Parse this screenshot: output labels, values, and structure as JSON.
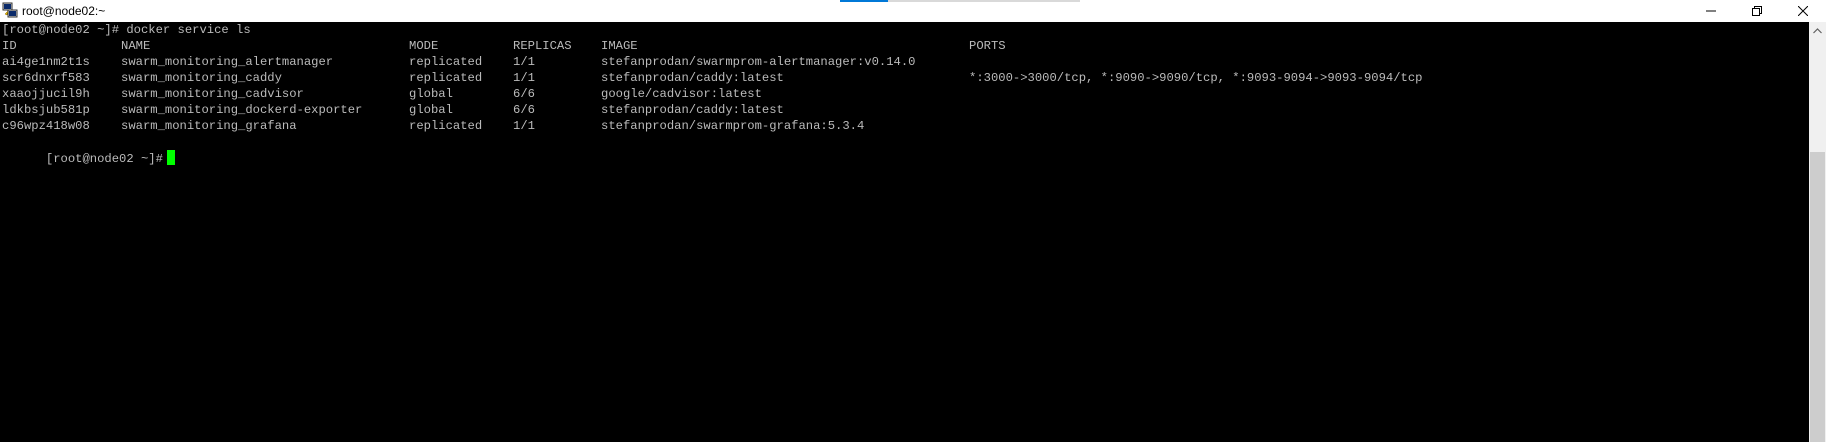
{
  "window": {
    "title": "root@node02:~"
  },
  "terminal": {
    "command_line": "[root@node02 ~]# docker service ls",
    "headers": {
      "id": "ID",
      "name": "NAME",
      "mode": "MODE",
      "replicas": "REPLICAS",
      "image": "IMAGE",
      "ports": "PORTS"
    },
    "rows": [
      {
        "id": "ai4ge1nm2t1s",
        "name": "swarm_monitoring_alertmanager",
        "mode": "replicated",
        "replicas": "1/1",
        "image": "stefanprodan/swarmprom-alertmanager:v0.14.0",
        "ports": ""
      },
      {
        "id": "scr6dnxrf583",
        "name": "swarm_monitoring_caddy",
        "mode": "replicated",
        "replicas": "1/1",
        "image": "stefanprodan/caddy:latest",
        "ports": "*:3000->3000/tcp, *:9090->9090/tcp, *:9093-9094->9093-9094/tcp"
      },
      {
        "id": "xaaojjucil9h",
        "name": "swarm_monitoring_cadvisor",
        "mode": "global",
        "replicas": "6/6",
        "image": "google/cadvisor:latest",
        "ports": ""
      },
      {
        "id": "ldkbsjub581p",
        "name": "swarm_monitoring_dockerd-exporter",
        "mode": "global",
        "replicas": "6/6",
        "image": "stefanprodan/caddy:latest",
        "ports": ""
      },
      {
        "id": "c96wpz418w08",
        "name": "swarm_monitoring_grafana",
        "mode": "replicated",
        "replicas": "1/1",
        "image": "stefanprodan/swarmprom-grafana:5.3.4",
        "ports": ""
      }
    ],
    "prompt": "[root@node02 ~]#",
    "colors": {
      "background": "#000000",
      "text": "#bbbbbb",
      "cursor": "#00ff00"
    }
  },
  "icons": {
    "app": "putty-icon",
    "minimize": "minimize-icon",
    "restore": "restore-icon",
    "close": "close-icon",
    "scroll_up": "chevron-up-icon"
  }
}
